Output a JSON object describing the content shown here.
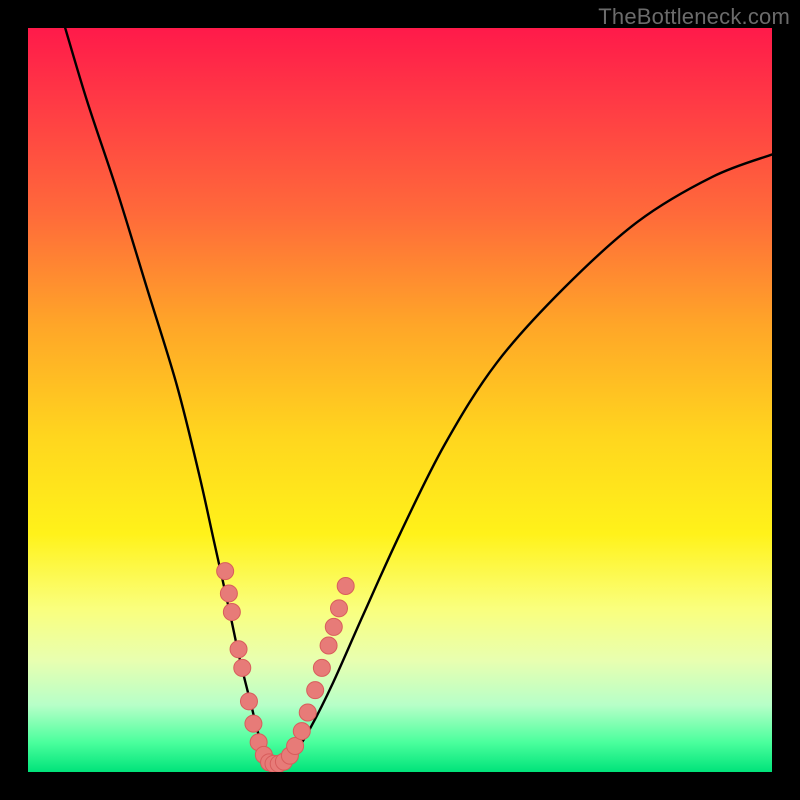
{
  "watermark": "TheBottleneck.com",
  "colors": {
    "frame": "#000000",
    "curve": "#000000",
    "marker_fill": "#e77b78",
    "marker_stroke": "#d85d5c",
    "gradient_top": "#ff1a4a",
    "gradient_bottom": "#00e37a"
  },
  "chart_data": {
    "type": "line",
    "title": "",
    "xlabel": "",
    "ylabel": "",
    "xlim": [
      0,
      100
    ],
    "ylim": [
      0,
      100
    ],
    "grid": false,
    "legend": false,
    "series": [
      {
        "name": "bottleneck-curve",
        "x": [
          5,
          8,
          12,
          16,
          20,
          23,
          25,
          27,
          28.5,
          30,
          31,
          32,
          33,
          34,
          36,
          38,
          41,
          45,
          50,
          56,
          63,
          72,
          82,
          92,
          100
        ],
        "y": [
          100,
          90,
          78,
          65,
          52,
          40,
          31,
          22,
          15,
          9,
          5,
          2.5,
          1.2,
          1.2,
          2.8,
          6,
          12,
          21,
          32,
          44,
          55,
          65,
          74,
          80,
          83
        ]
      }
    ],
    "scatter": [
      {
        "name": "left-branch-markers",
        "points": [
          {
            "x": 26.5,
            "y": 27
          },
          {
            "x": 27.0,
            "y": 24
          },
          {
            "x": 27.4,
            "y": 21.5
          },
          {
            "x": 28.3,
            "y": 16.5
          },
          {
            "x": 28.8,
            "y": 14
          },
          {
            "x": 29.7,
            "y": 9.5
          },
          {
            "x": 30.3,
            "y": 6.5
          },
          {
            "x": 31.0,
            "y": 4.0
          },
          {
            "x": 31.7,
            "y": 2.3
          }
        ]
      },
      {
        "name": "bottom-markers",
        "points": [
          {
            "x": 32.4,
            "y": 1.3
          },
          {
            "x": 33.0,
            "y": 1.1
          },
          {
            "x": 33.7,
            "y": 1.1
          },
          {
            "x": 34.4,
            "y": 1.4
          }
        ]
      },
      {
        "name": "right-branch-markers",
        "points": [
          {
            "x": 35.2,
            "y": 2.2
          },
          {
            "x": 35.9,
            "y": 3.5
          },
          {
            "x": 36.8,
            "y": 5.5
          },
          {
            "x": 37.6,
            "y": 8.0
          },
          {
            "x": 38.6,
            "y": 11.0
          },
          {
            "x": 39.5,
            "y": 14.0
          },
          {
            "x": 40.4,
            "y": 17.0
          },
          {
            "x": 41.1,
            "y": 19.5
          },
          {
            "x": 41.8,
            "y": 22.0
          },
          {
            "x": 42.7,
            "y": 25.0
          }
        ]
      }
    ]
  }
}
